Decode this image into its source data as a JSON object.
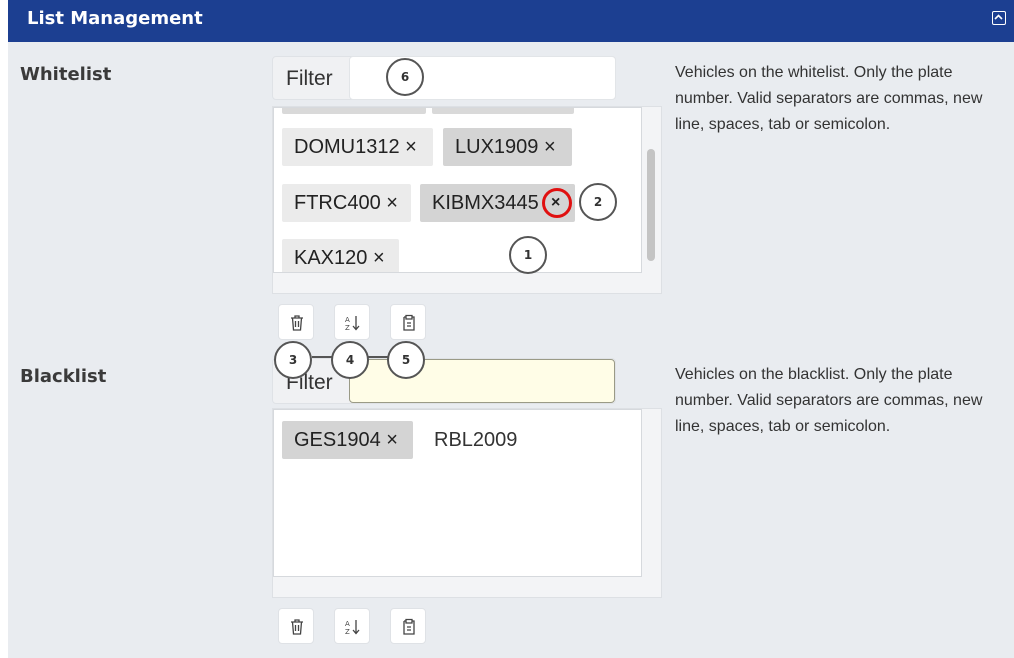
{
  "header": {
    "title": "List Management"
  },
  "whitelist": {
    "label": "Whitelist",
    "filter_label": "Filter",
    "filter_value": "",
    "tags": [
      "DOMU1312 ×",
      "LUX1909 ×",
      "FTRC400 ×",
      "KIBMX3445",
      "KAX120 ×"
    ],
    "remove_symbol": "×",
    "description": "Vehicles on the whitelist. Only the plate number. Valid separators are commas, new line, spaces, tab or semicolon."
  },
  "blacklist": {
    "label": "Blacklist",
    "filter_label": "Filter",
    "filter_value": "",
    "tags": [
      "GES1904 ×"
    ],
    "plain_entry": "RBL2009",
    "description": "Vehicles on the blacklist. Only the plate number. Valid separators are commas, new line, spaces, tab or semicolon."
  },
  "toolbar_icons": [
    "trash-icon",
    "sort-az-icon",
    "clipboard-icon"
  ],
  "callouts": [
    "1",
    "2",
    "3",
    "4",
    "5",
    "6"
  ],
  "colors": {
    "header_bg": "#1c3f91",
    "panel_bg": "#e9ecf0",
    "highlight_red": "#e01010",
    "active_input_bg": "#fffde7"
  }
}
